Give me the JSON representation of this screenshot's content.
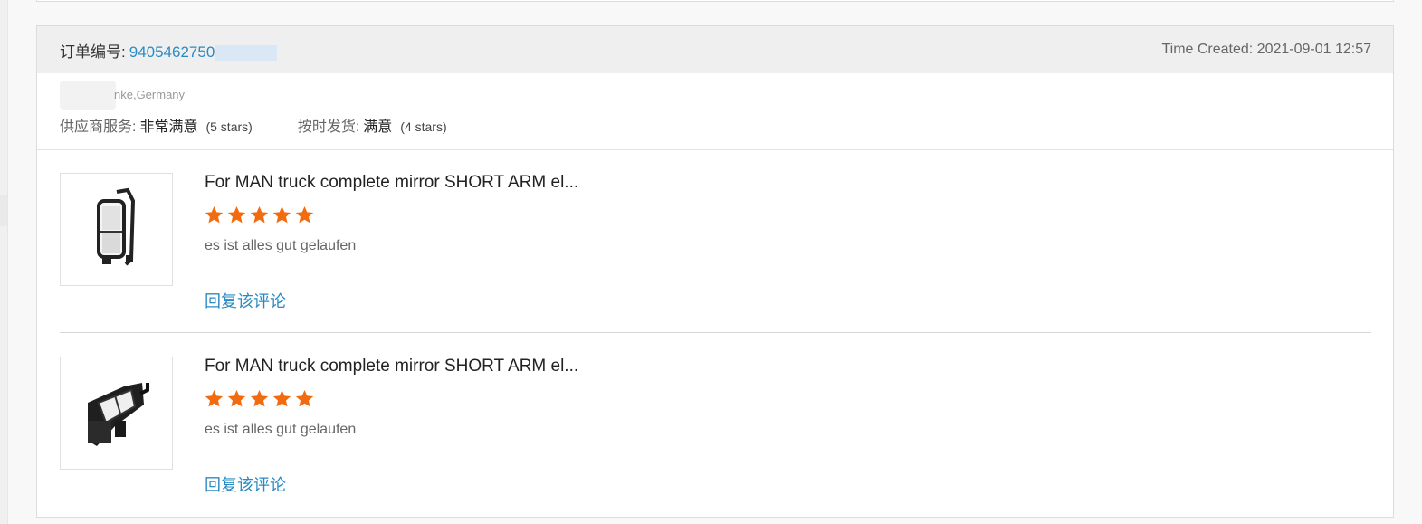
{
  "order": {
    "label": "订单编号:",
    "number": "9405462750",
    "time_created": "Time Created: 2021-09-01 12:57"
  },
  "buyer": {
    "location": "nke,Germany"
  },
  "ratings": [
    {
      "label": "供应商服务:",
      "value": "非常满意",
      "stars": "(5 stars)"
    },
    {
      "label": "按时发货:",
      "value": "满意",
      "stars": "(4 stars)"
    }
  ],
  "reviews": [
    {
      "title": "For MAN truck complete mirror SHORT ARM el...",
      "rating": 5,
      "comment": "es ist alles gut gelaufen",
      "reply_label": "回复该评论",
      "image_icon": "truck-mirror-icon"
    },
    {
      "title": "For MAN truck complete mirror SHORT ARM el...",
      "rating": 5,
      "comment": "es ist alles gut gelaufen",
      "reply_label": "回复该评论",
      "image_icon": "truck-mirror-icon"
    }
  ],
  "colors": {
    "link": "#2a8bc3",
    "star": "#f26b0f",
    "header_bg": "#efefef"
  }
}
